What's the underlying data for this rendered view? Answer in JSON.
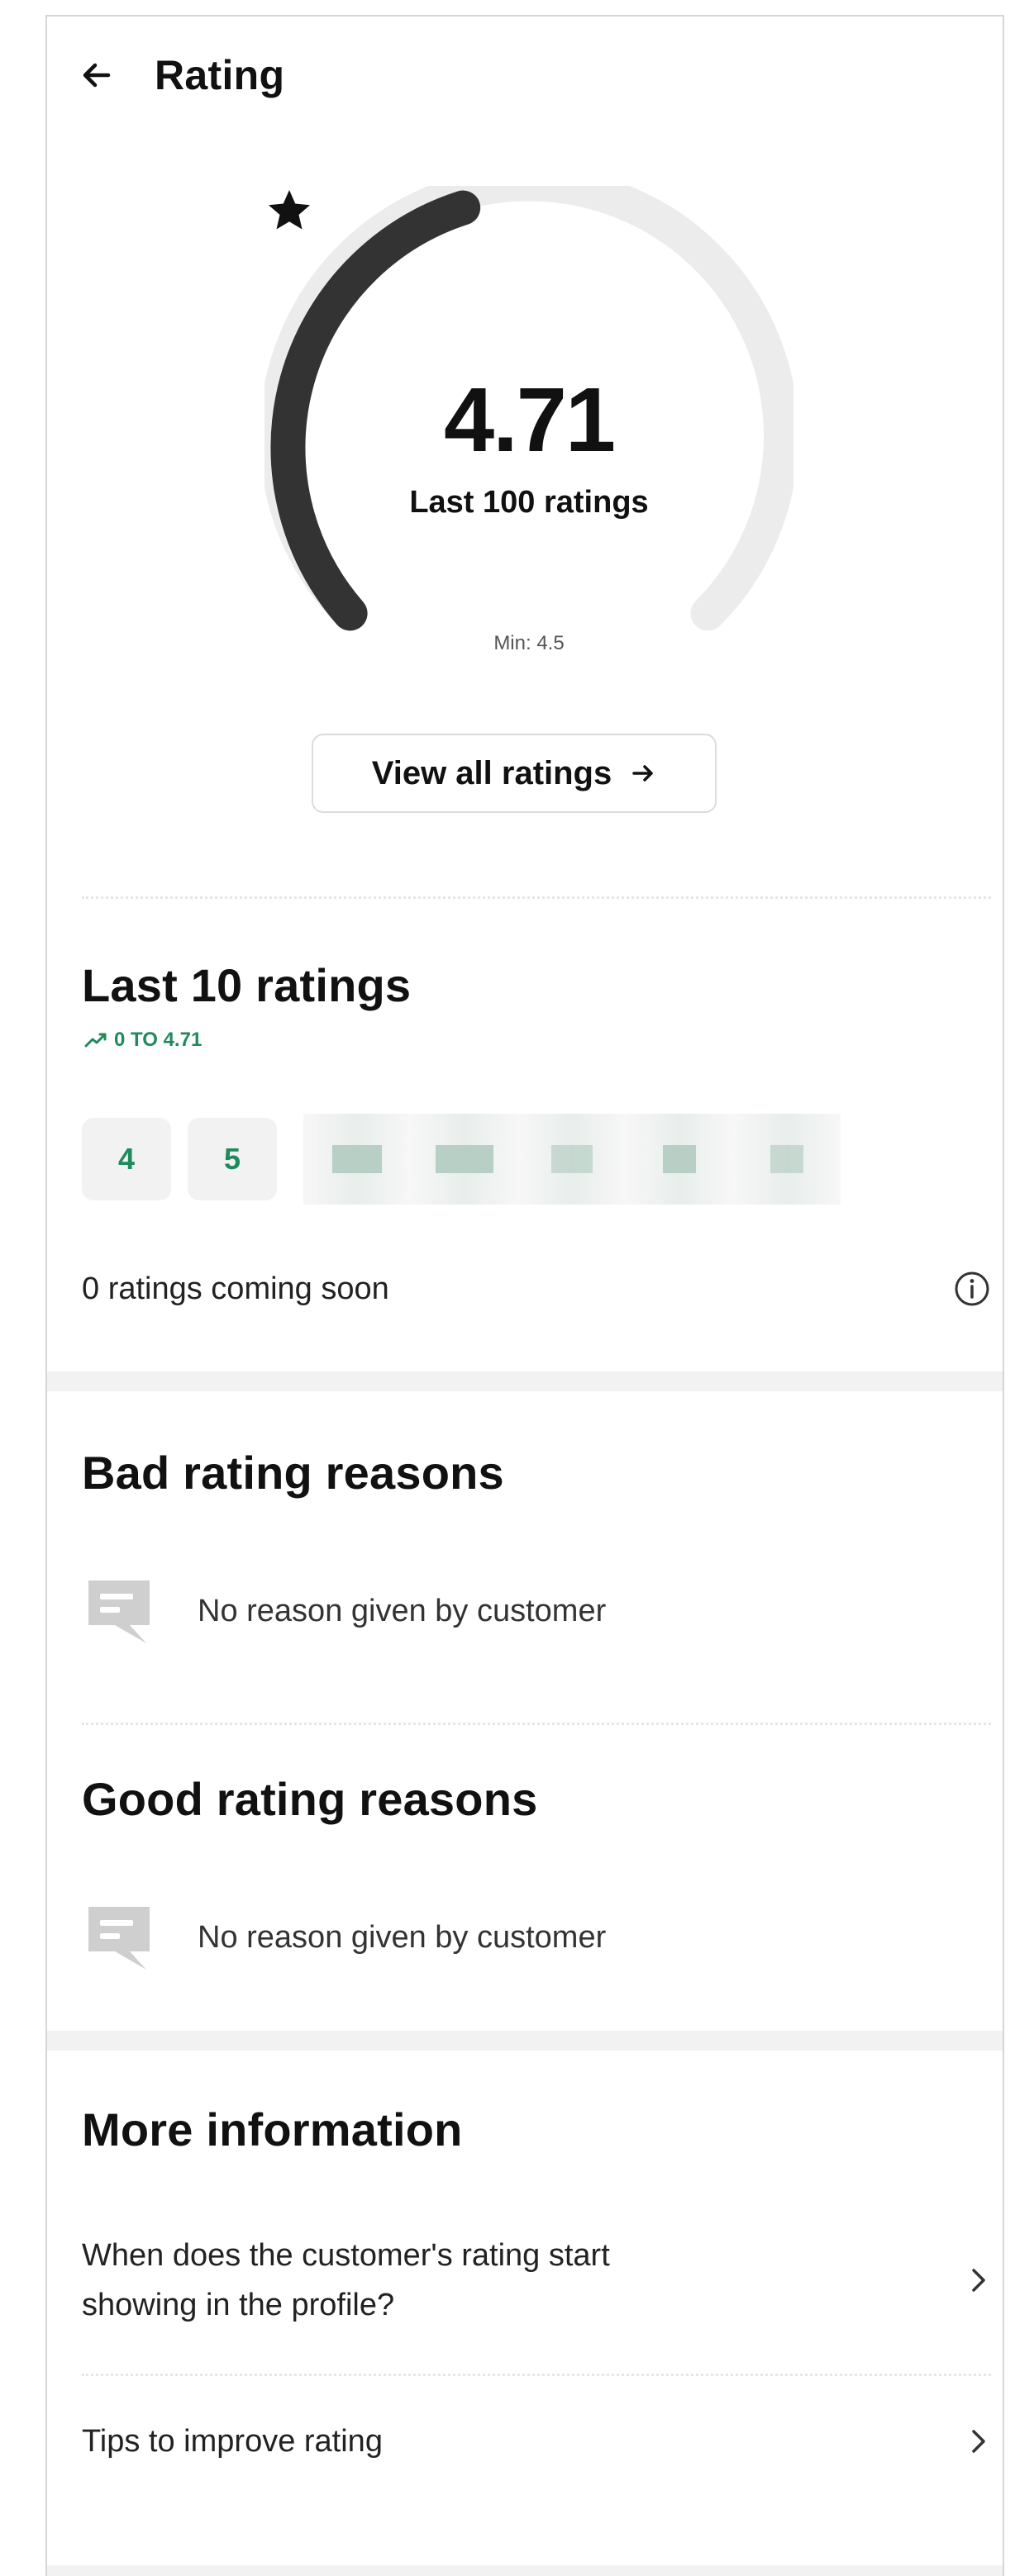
{
  "header": {
    "title": "Rating"
  },
  "summary": {
    "score": "4.71",
    "caption": "Last 100 ratings",
    "min_label": "Min: 4.5",
    "gauge_fill_fraction": 0.3
  },
  "view_all": {
    "label": "View all ratings"
  },
  "last10": {
    "title": "Last 10 ratings",
    "trend": "0 TO 4.71",
    "chips": [
      "4",
      "5"
    ],
    "coming_soon": "0 ratings coming soon"
  },
  "bad": {
    "title": "Bad rating reasons",
    "reason": "No reason given by customer"
  },
  "good": {
    "title": "Good rating reasons",
    "reason": "No reason given by customer"
  },
  "more_info": {
    "title": "More information",
    "items": [
      {
        "line1": "When does the customer's rating start",
        "line2": "showing in the profile?"
      },
      {
        "line1": "Tips to improve rating"
      }
    ]
  },
  "colors": {
    "accent": "#1f8a5b",
    "gauge_fill": "#333333",
    "gauge_track": "#ececec"
  }
}
